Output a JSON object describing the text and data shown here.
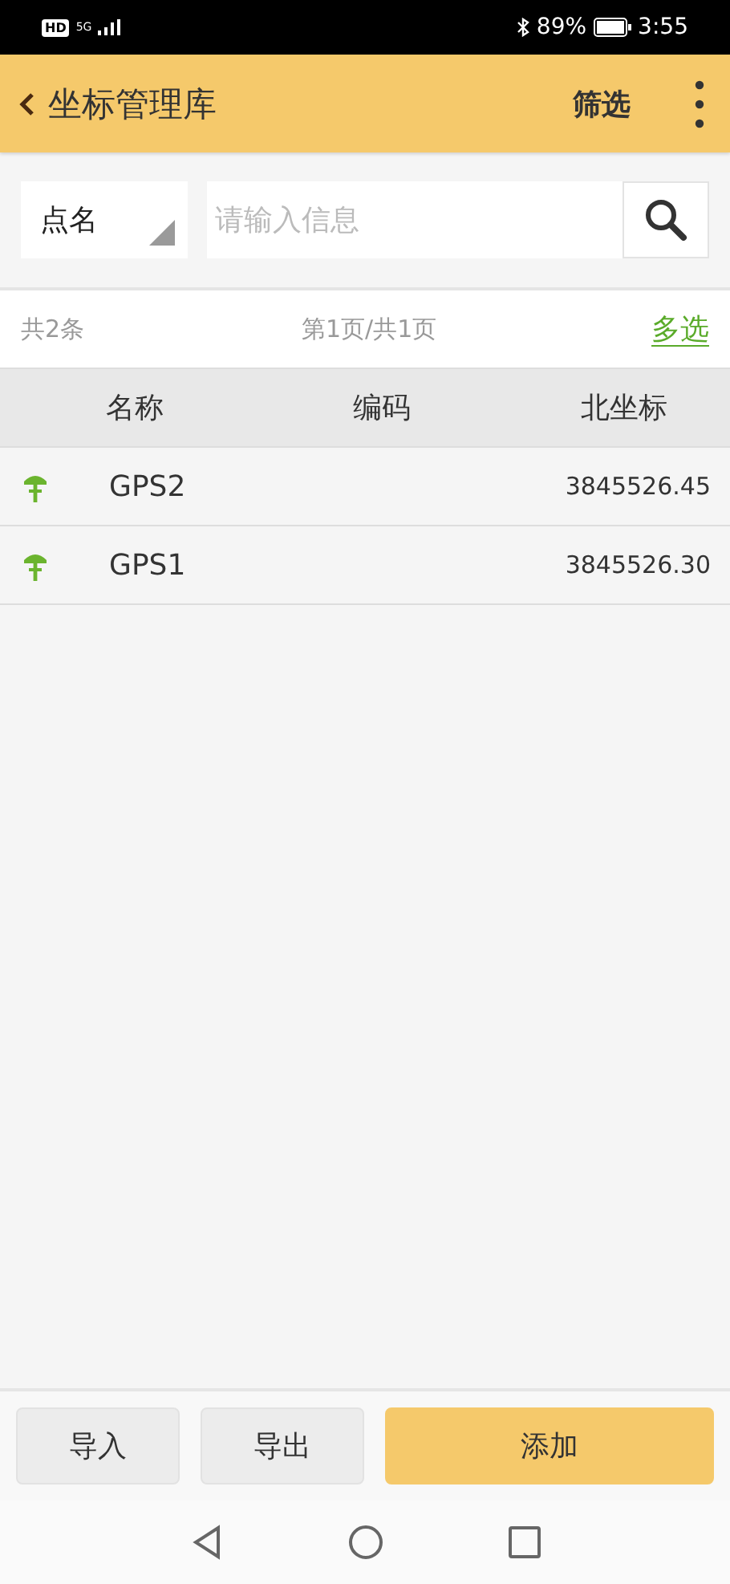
{
  "status_bar": {
    "hd": "HD",
    "network": "5G",
    "battery": "89%",
    "time": "3:55"
  },
  "header": {
    "title": "坐标管理库",
    "filter": "筛选"
  },
  "search": {
    "field_type": "点名",
    "placeholder": "请输入信息"
  },
  "info": {
    "count": "共2条",
    "page": "第1页/共1页",
    "multi_select": "多选"
  },
  "table": {
    "columns": [
      "名称",
      "编码",
      "北坐标"
    ],
    "rows": [
      {
        "name": "GPS2",
        "code": "",
        "north": "3845526.45"
      },
      {
        "name": "GPS1",
        "code": "",
        "north": "3845526.30"
      }
    ]
  },
  "buttons": [
    {
      "label": "导入",
      "kind": "secondary"
    },
    {
      "label": "导出",
      "kind": "secondary"
    },
    {
      "label": "添加",
      "kind": "primary"
    }
  ]
}
